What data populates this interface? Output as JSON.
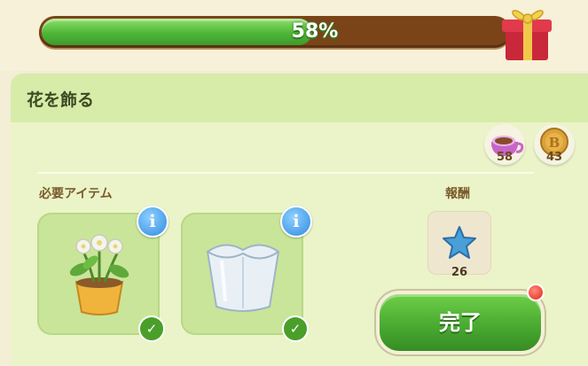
{
  "progress": {
    "percent_label": "58%",
    "value": 0.58
  },
  "quest": {
    "title": "花を飾る"
  },
  "resources": [
    {
      "icon": "teacup-icon",
      "value": "58"
    },
    {
      "icon": "coin-icon",
      "value": "43"
    }
  ],
  "sections": {
    "required_items_label": "必要アイテム",
    "reward_label": "報酬"
  },
  "required_items": [
    {
      "icon": "potted-white-flower-icon",
      "info": "i",
      "completed": true
    },
    {
      "icon": "glass-vase-icon",
      "info": "i",
      "completed": true
    }
  ],
  "reward": {
    "icon": "blue-star-icon",
    "count": "26"
  },
  "complete_button": {
    "label": "完了"
  },
  "colors": {
    "accent_green": "#4fb638",
    "progress_bg": "#7a4418",
    "panel": "#eaf4c8"
  }
}
